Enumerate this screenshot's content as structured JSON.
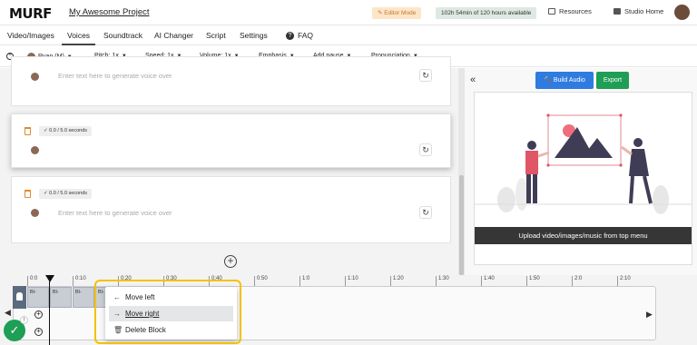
{
  "header": {
    "logo": "MURF",
    "project_title": "My Awesome Project",
    "editor_mode": "Editor Mode",
    "hours_available": "102h 54min of 120 hours available",
    "resources": "Resources",
    "studio_home": "Studio Home"
  },
  "tabs": [
    "Video/Images",
    "Voices",
    "Soundtrack",
    "AI Changer",
    "Script",
    "Settings",
    "FAQ"
  ],
  "active_tab": "Voices",
  "toolbar": {
    "voice": "Ryan (M)",
    "pitch": "Pitch: 1x",
    "speed": "Speed: 1x",
    "volume": "Volume: 1x",
    "emphasis": "Emphasis",
    "add_pause": "Add pause",
    "pronunciation": "Pronunciation"
  },
  "blocks": [
    {
      "time": "",
      "placeholder": "Enter text here to generate voice over"
    },
    {
      "time": "0.0 / 5.0 seconds",
      "placeholder": ""
    },
    {
      "time": "0.0 / 5.0 seconds",
      "placeholder": "Enter text here to generate voice over"
    }
  ],
  "right_panel": {
    "build_audio": "Build Audio",
    "export": "Export",
    "upload_caption": "Upload video/images/music from top menu"
  },
  "timeline": {
    "ticks": [
      "0:0",
      "0:10",
      "0:20",
      "0:30",
      "0:40",
      "0:50",
      "1:0",
      "1:10",
      "1:20",
      "1:30",
      "1:40",
      "1:50",
      "2:0",
      "2:10"
    ],
    "clip_label": "Bl-"
  },
  "context_menu": {
    "move_left": "Move left",
    "move_right": "Move right",
    "delete_block": "Delete Block"
  }
}
